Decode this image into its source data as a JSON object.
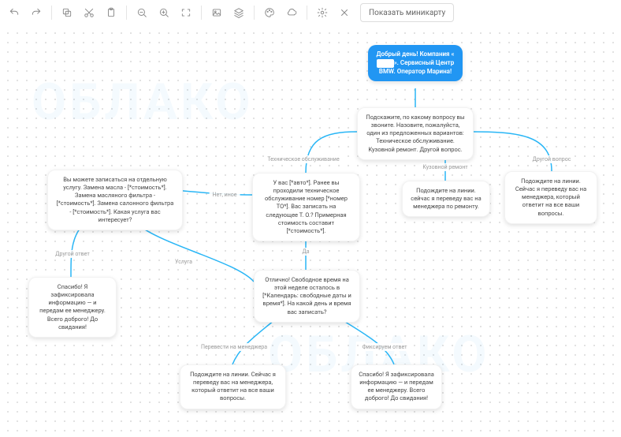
{
  "toolbar": {
    "minimap_label": "Показать миникарту",
    "icons": [
      "undo",
      "redo",
      "copy",
      "cut",
      "paste",
      "zoom-out",
      "zoom-in",
      "fit",
      "image",
      "layers",
      "palette",
      "cloud",
      "settings",
      "close"
    ]
  },
  "nodes": {
    "root": "Добрый день! Компания «__________». Сервисный Центр BMW. Оператор Марина!",
    "root_accent": "________",
    "q_reason": "Подскажите, по какому вопросу вы звоните. Назовите, пожалуйста, один из предложенных вариантов: Техническое обслуживание. Кузовной ремонт. Другой вопрос.",
    "other_q": "Подождите на линии. Сейчас я переведу вас на менеджера, который ответит на все ваши вопросы.",
    "body_repair": "Подождите на линии. сейчас я переведу вас на менеджера по ремонту.",
    "tech_service": "У вас [*авто*]. Ранее вы проходили техническое обслуживание номер [*номер ТО*]. Вас записать на следующее Т. О.? Примерная стоимость составит [*стоимость*].",
    "services_list": "Вы можете записаться на отдельную услугу. Замена масла - [*стоимость*]. Замена масляного фильтра - [*стоимость*]. Замена салонного фильтра - [*стоимость*]. Какая услуга вас интересует?",
    "thanks_left": "Спасибо! Я зафиксировала информацию — и передам ее менеджеру. Всего доброго! До свидания!",
    "free_time": "Отлично! Свободное время на этой неделе осталось в [*Календарь: свободные даты и время*]. На какой день и время вас записать?",
    "wait_manager": "Подождите на линии. Сейчас я переведу вас на менеджера, который ответит на все ваши вопросы.",
    "thanks_right": "Спасибо! Я зафиксировала информацию — и передам ее менеджеру. Всего доброго! До свидания!"
  },
  "edges": {
    "tech": "Техническое обслуживание",
    "body": "Кузовной ремонт",
    "other": "Другой вопрос",
    "no_other": "Нет, иное",
    "yes": "Да",
    "other_ans": "Другой ответ",
    "service": "Услуга",
    "to_manager": "Перевести на менеджера",
    "fix_ans": "Фиксируем ответ"
  }
}
